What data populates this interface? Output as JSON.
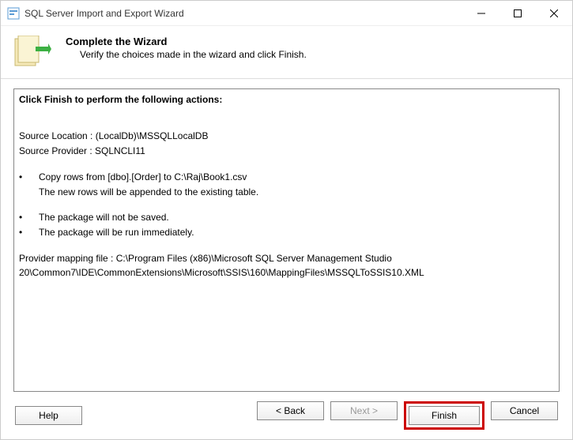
{
  "titlebar": {
    "title": "SQL Server Import and Export Wizard"
  },
  "header": {
    "title": "Complete the Wizard",
    "subtitle": "Verify the choices made in the wizard and click Finish."
  },
  "content": {
    "heading": "Click Finish to perform the following actions:",
    "source_location": "Source Location : (LocalDb)\\MSSQLLocalDB",
    "source_provider": "Source Provider : SQLNCLI11",
    "copy_action": "Copy rows from [dbo].[Order] to C:\\Raj\\Book1.csv",
    "copy_note": "The new rows will be appended to the existing table.",
    "save_note": "The package will not be saved.",
    "run_note": "The package will be run immediately.",
    "mapping_file": "Provider mapping file : C:\\Program Files (x86)\\Microsoft SQL Server Management Studio 20\\Common7\\IDE\\CommonExtensions\\Microsoft\\SSIS\\160\\MappingFiles\\MSSQLToSSIS10.XML"
  },
  "buttons": {
    "help": "Help",
    "back": "< Back",
    "next": "Next >",
    "finish": "Finish",
    "cancel": "Cancel"
  }
}
